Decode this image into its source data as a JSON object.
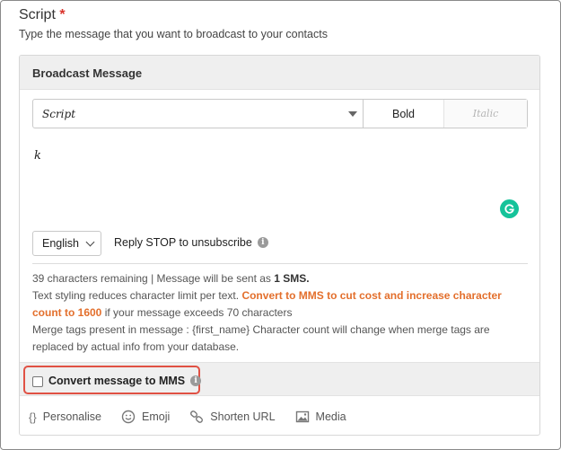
{
  "section": {
    "title": "Script",
    "required_mark": "*",
    "subtitle": "Type the message that you want to broadcast to your contacts"
  },
  "card": {
    "header": "Broadcast Message"
  },
  "toolbar": {
    "font_value": "Script",
    "bold_label": "Bold",
    "italic_label": "Italic"
  },
  "editor": {
    "text": "k"
  },
  "language": {
    "selected": "English"
  },
  "reply_stop": {
    "label": "Reply STOP to unsubscribe"
  },
  "info": {
    "remaining": "39 characters remaining | Message will be sent as",
    "sms_count": "1 SMS.",
    "styling_prefix": "Text styling reduces character limit per text.",
    "mms_link": "Convert to MMS to cut cost and increase character count to 1600",
    "styling_suffix": "if your message exceeds 70 characters",
    "merge_tags": "Merge tags present in message : {first_name} Character count will change when merge tags are replaced by actual info from your database."
  },
  "mms": {
    "label": "Convert message to MMS",
    "checked": false
  },
  "footer": {
    "items": [
      {
        "label": "Personalise",
        "icon": "braces-icon"
      },
      {
        "label": "Emoji",
        "icon": "smiley-icon"
      },
      {
        "label": "Shorten URL",
        "icon": "link-icon"
      },
      {
        "label": "Media",
        "icon": "image-icon"
      }
    ]
  },
  "colors": {
    "accent_orange": "#e36f2c",
    "highlight_red": "#e05144",
    "grammarly_green": "#15c39a",
    "required_red": "#d9332b"
  }
}
